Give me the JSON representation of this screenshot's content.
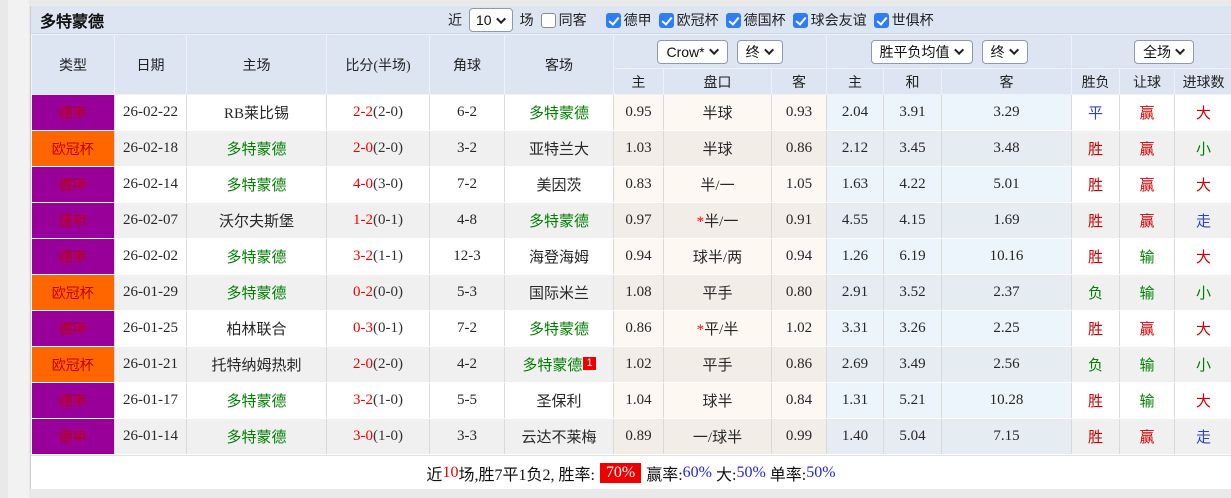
{
  "palette": {
    "bundesliga_badge": "#990099",
    "champions_league_badge": "#ff6600",
    "team_highlight_green": "#008000",
    "score_red": "#ee0000",
    "result_red": "#cc0000",
    "result_green": "#008000",
    "result_blue": "#2945c4",
    "header_bg": "#dce5f1",
    "alt_row_bg": "#f0f0f0",
    "footer_rate_badge_bg": "#ee0000",
    "footer_value_blue": "#2424dd"
  },
  "title": "多特蒙德",
  "controls": {
    "recent_label": "近",
    "recent_count": "10",
    "matches_label": "场",
    "checkboxes": [
      {
        "label": "同客",
        "checked": false,
        "cls": "cb"
      },
      {
        "label": "德甲",
        "checked": true,
        "cls": "cb on"
      },
      {
        "label": "欧冠杯",
        "checked": true,
        "cls": "cb on"
      },
      {
        "label": "德国杯",
        "checked": true,
        "cls": "cb on"
      },
      {
        "label": "球会友谊",
        "checked": true,
        "cls": "cb on"
      },
      {
        "label": "世俱杯",
        "checked": true,
        "cls": "cb on"
      }
    ]
  },
  "selects": {
    "bookmaker": "Crow*",
    "bookmaker_state": "终",
    "europe": "胜平负均值",
    "europe_state": "终",
    "scope": "全场"
  },
  "headers": {
    "type": "类型",
    "date": "日期",
    "home": "主场",
    "score": "比分(半场)",
    "corner": "角球",
    "away": "客场",
    "ah_home": "主",
    "ah_line": "盘口",
    "ah_away": "客",
    "eu_home": "主",
    "eu_draw": "和",
    "eu_away": "客",
    "wl": "胜负",
    "handicap": "让球",
    "goals": "进球数"
  },
  "rows": [
    {
      "league": {
        "text": "德甲",
        "cls": "lg purple"
      },
      "date": "26-02-22",
      "home": {
        "text": "RB莱比锡",
        "cls": "tm"
      },
      "score": "2-2",
      "half": "(2-0)",
      "corner": "6-2",
      "away": {
        "text": "多特蒙德",
        "cls": "tm grn",
        "badge": ""
      },
      "ah": {
        "home": "0.95",
        "star": "",
        "line": "半球",
        "away": "0.93"
      },
      "eu": {
        "home": "2.04",
        "draw": "3.91",
        "away": "3.29"
      },
      "res": {
        "wl": {
          "text": "平",
          "cls": "c-blu"
        },
        "hc": {
          "text": "赢",
          "cls": "c-red"
        },
        "goals": {
          "text": "大",
          "cls": "c-red"
        }
      }
    },
    {
      "league": {
        "text": "欧冠杯",
        "cls": "lg orange"
      },
      "date": "26-02-18",
      "home": {
        "text": "多特蒙德",
        "cls": "tm grn"
      },
      "score": "2-0",
      "half": "(2-0)",
      "corner": "3-2",
      "away": {
        "text": "亚特兰大",
        "cls": "tm",
        "badge": ""
      },
      "ah": {
        "home": "1.03",
        "star": "",
        "line": "半球",
        "away": "0.86"
      },
      "eu": {
        "home": "2.12",
        "draw": "3.45",
        "away": "3.48"
      },
      "res": {
        "wl": {
          "text": "胜",
          "cls": "c-red"
        },
        "hc": {
          "text": "赢",
          "cls": "c-red"
        },
        "goals": {
          "text": "小",
          "cls": "c-grn"
        }
      }
    },
    {
      "league": {
        "text": "德甲",
        "cls": "lg purple"
      },
      "date": "26-02-14",
      "home": {
        "text": "多特蒙德",
        "cls": "tm grn"
      },
      "score": "4-0",
      "half": "(3-0)",
      "corner": "7-2",
      "away": {
        "text": "美因茨",
        "cls": "tm",
        "badge": ""
      },
      "ah": {
        "home": "0.83",
        "star": "",
        "line": "半/一",
        "away": "1.05"
      },
      "eu": {
        "home": "1.63",
        "draw": "4.22",
        "away": "5.01"
      },
      "res": {
        "wl": {
          "text": "胜",
          "cls": "c-red"
        },
        "hc": {
          "text": "赢",
          "cls": "c-red"
        },
        "goals": {
          "text": "大",
          "cls": "c-red"
        }
      }
    },
    {
      "league": {
        "text": "德甲",
        "cls": "lg purple"
      },
      "date": "26-02-07",
      "home": {
        "text": "沃尔夫斯堡",
        "cls": "tm"
      },
      "score": "1-2",
      "half": "(0-1)",
      "corner": "4-8",
      "away": {
        "text": "多特蒙德",
        "cls": "tm grn",
        "badge": ""
      },
      "ah": {
        "home": "0.97",
        "star": "*",
        "line": "半/一",
        "away": "0.91"
      },
      "eu": {
        "home": "4.55",
        "draw": "4.15",
        "away": "1.69"
      },
      "res": {
        "wl": {
          "text": "胜",
          "cls": "c-red"
        },
        "hc": {
          "text": "赢",
          "cls": "c-red"
        },
        "goals": {
          "text": "走",
          "cls": "c-blu"
        }
      }
    },
    {
      "league": {
        "text": "德甲",
        "cls": "lg purple"
      },
      "date": "26-02-02",
      "home": {
        "text": "多特蒙德",
        "cls": "tm grn"
      },
      "score": "3-2",
      "half": "(1-1)",
      "corner": "12-3",
      "away": {
        "text": "海登海姆",
        "cls": "tm",
        "badge": ""
      },
      "ah": {
        "home": "0.94",
        "star": "",
        "line": "球半/两",
        "away": "0.94"
      },
      "eu": {
        "home": "1.26",
        "draw": "6.19",
        "away": "10.16"
      },
      "res": {
        "wl": {
          "text": "胜",
          "cls": "c-red"
        },
        "hc": {
          "text": "输",
          "cls": "c-grn"
        },
        "goals": {
          "text": "大",
          "cls": "c-red"
        }
      }
    },
    {
      "league": {
        "text": "欧冠杯",
        "cls": "lg orange"
      },
      "date": "26-01-29",
      "home": {
        "text": "多特蒙德",
        "cls": "tm grn"
      },
      "score": "0-2",
      "half": "(0-0)",
      "corner": "5-3",
      "away": {
        "text": "国际米兰",
        "cls": "tm",
        "badge": ""
      },
      "ah": {
        "home": "1.08",
        "star": "",
        "line": "平手",
        "away": "0.80"
      },
      "eu": {
        "home": "2.91",
        "draw": "3.52",
        "away": "2.37"
      },
      "res": {
        "wl": {
          "text": "负",
          "cls": "c-grn"
        },
        "hc": {
          "text": "输",
          "cls": "c-grn"
        },
        "goals": {
          "text": "小",
          "cls": "c-grn"
        }
      }
    },
    {
      "league": {
        "text": "德甲",
        "cls": "lg purple"
      },
      "date": "26-01-25",
      "home": {
        "text": "柏林联合",
        "cls": "tm"
      },
      "score": "0-3",
      "half": "(0-1)",
      "corner": "7-2",
      "away": {
        "text": "多特蒙德",
        "cls": "tm grn",
        "badge": ""
      },
      "ah": {
        "home": "0.86",
        "star": "*",
        "line": "平/半",
        "away": "1.02"
      },
      "eu": {
        "home": "3.31",
        "draw": "3.26",
        "away": "2.25"
      },
      "res": {
        "wl": {
          "text": "胜",
          "cls": "c-red"
        },
        "hc": {
          "text": "赢",
          "cls": "c-red"
        },
        "goals": {
          "text": "大",
          "cls": "c-red"
        }
      }
    },
    {
      "league": {
        "text": "欧冠杯",
        "cls": "lg orange"
      },
      "date": "26-01-21",
      "home": {
        "text": "托特纳姆热刺",
        "cls": "tm"
      },
      "score": "2-0",
      "half": "(2-0)",
      "corner": "4-2",
      "away": {
        "text": "多特蒙德",
        "cls": "tm grn",
        "badge": "1"
      },
      "ah": {
        "home": "1.02",
        "star": "",
        "line": "平手",
        "away": "0.86"
      },
      "eu": {
        "home": "2.69",
        "draw": "3.49",
        "away": "2.56"
      },
      "res": {
        "wl": {
          "text": "负",
          "cls": "c-grn"
        },
        "hc": {
          "text": "输",
          "cls": "c-grn"
        },
        "goals": {
          "text": "小",
          "cls": "c-grn"
        }
      }
    },
    {
      "league": {
        "text": "德甲",
        "cls": "lg purple"
      },
      "date": "26-01-17",
      "home": {
        "text": "多特蒙德",
        "cls": "tm grn"
      },
      "score": "3-2",
      "half": "(1-0)",
      "corner": "5-5",
      "away": {
        "text": "圣保利",
        "cls": "tm",
        "badge": ""
      },
      "ah": {
        "home": "1.04",
        "star": "",
        "line": "球半",
        "away": "0.84"
      },
      "eu": {
        "home": "1.31",
        "draw": "5.21",
        "away": "10.28"
      },
      "res": {
        "wl": {
          "text": "胜",
          "cls": "c-red"
        },
        "hc": {
          "text": "输",
          "cls": "c-grn"
        },
        "goals": {
          "text": "大",
          "cls": "c-red"
        }
      }
    },
    {
      "league": {
        "text": "德甲",
        "cls": "lg purple"
      },
      "date": "26-01-14",
      "home": {
        "text": "多特蒙德",
        "cls": "tm grn"
      },
      "score": "3-0",
      "half": "(1-0)",
      "corner": "3-3",
      "away": {
        "text": "云达不莱梅",
        "cls": "tm",
        "badge": ""
      },
      "ah": {
        "home": "0.89",
        "star": "",
        "line": "一/球半",
        "away": "0.99"
      },
      "eu": {
        "home": "1.40",
        "draw": "5.04",
        "away": "7.15"
      },
      "res": {
        "wl": {
          "text": "胜",
          "cls": "c-red"
        },
        "hc": {
          "text": "赢",
          "cls": "c-red"
        },
        "goals": {
          "text": "走",
          "cls": "c-blu"
        }
      }
    }
  ],
  "footer": {
    "prefix": "近",
    "count": "10",
    "summary": "场,胜7平1负2, 胜率:",
    "win_rate": "70%",
    "win_odds_label": "赢率:",
    "win_odds_rate": "60%",
    "big_label": " 大:",
    "big_rate": "50%",
    "single_label": " 单率:",
    "single_rate": "50%"
  }
}
